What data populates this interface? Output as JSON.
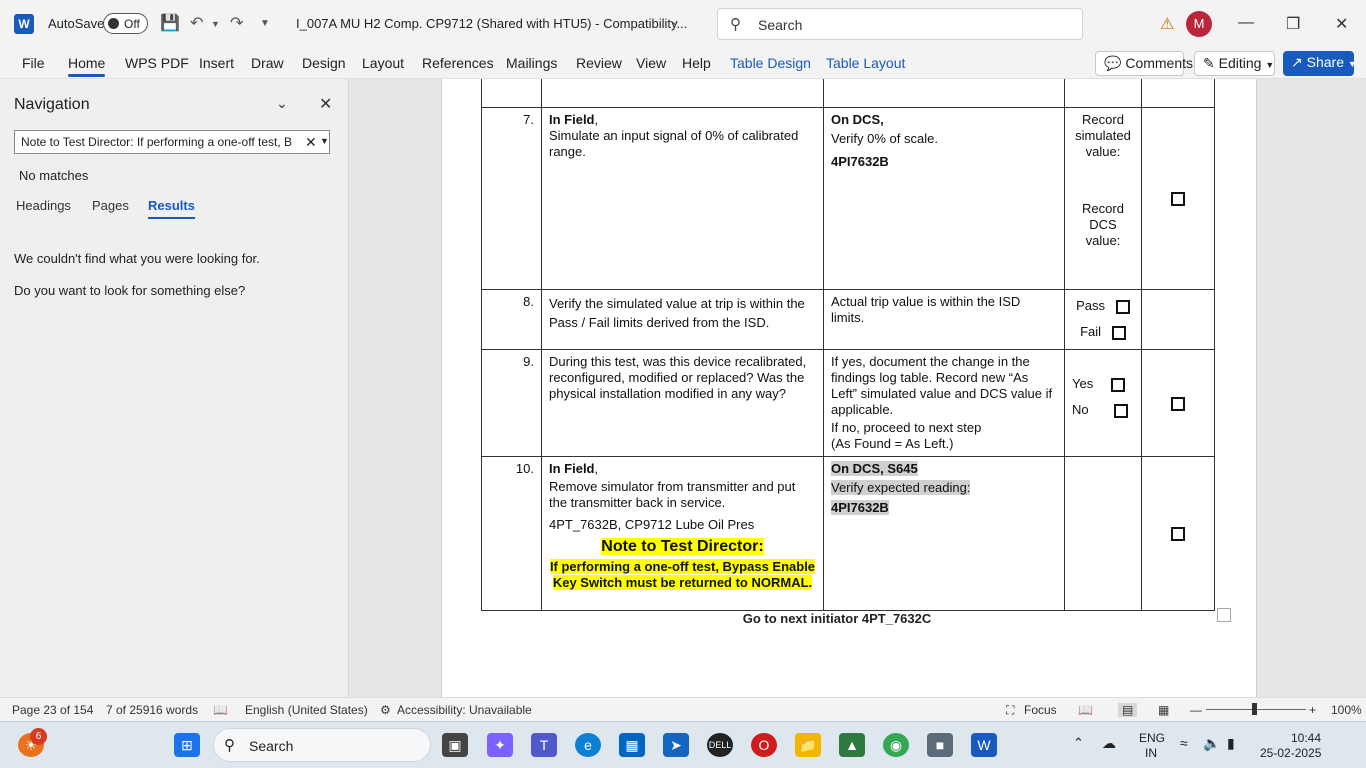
{
  "titlebar": {
    "autosave": "AutoSave",
    "autosave_state": "Off",
    "doc_title": "I_007A MU H2 Comp. CP9712 (Shared with HTU5)  -  Compatibility...",
    "search_placeholder": "Search",
    "avatar_initial": "M"
  },
  "ribbon": {
    "tabs": [
      "File",
      "Home",
      "WPS PDF",
      "Insert",
      "Draw",
      "Design",
      "Layout",
      "References",
      "Mailings",
      "Review",
      "View",
      "Help",
      "Table Design",
      "Table Layout"
    ],
    "comments": "Comments",
    "editing": "Editing",
    "share": "Share"
  },
  "nav": {
    "title": "Navigation",
    "search_value": "Note to Test Director: If performing a one-off test, B",
    "no_matches": "No matches",
    "tabs": [
      "Headings",
      "Pages",
      "Results"
    ],
    "msg1": "We couldn't find what you were looking for.",
    "msg2": "Do you want to look for something else?"
  },
  "doc": {
    "rows": [
      {
        "num": "7.",
        "c2_bold": "In Field",
        "c2_text": "Simulate an input signal of 0% of calibrated range.",
        "c3_bold": "On DCS,",
        "c3_text": "Verify 0% of scale.",
        "c3_tag": "4PI7632B",
        "c4_a": "Record simulated value:",
        "c4_b": "Record DCS value:"
      },
      {
        "num": "8.",
        "c2_text": "Verify the simulated value at trip is within the Pass / Fail limits derived from the ISD.",
        "c3_text": "Actual trip value is within the ISD limits.",
        "c4_a": "Pass",
        "c4_b": "Fail"
      },
      {
        "num": "9.",
        "c2_text": "During this test, was this device recalibrated, reconfigured, modified or replaced? Was the physical installation modified in any way?",
        "c3_text": "If yes, document the change in the findings log table. Record new “As Left” simulated value and DCS value if applicable.",
        "c3_text2": "If no, proceed to next step",
        "c3_text3": "(As Found = As Left.)",
        "c4_a": "Yes",
        "c4_b": "No"
      },
      {
        "num": "10.",
        "c2_bold": "In Field",
        "c2_text": "Remove simulator from transmitter and put the transmitter back in service.",
        "c2_text2": "4PT_7632B, CP9712 Lube Oil Pres",
        "note_heading": "Note to Test Director:",
        "note_body": "If performing a one-off test, Bypass Enable Key Switch must be returned to NORMAL.",
        "c3_bold": "On DCS, S645",
        "c3_text": "Verify expected reading:",
        "c3_tag": "4PI7632B"
      }
    ],
    "goto": "Go to next initiator 4PT_7632C"
  },
  "status": {
    "page": "Page 23 of 154",
    "words": "7 of 25916 words",
    "language": "English (United States)",
    "accessibility": "Accessibility: Unavailable",
    "focus": "Focus",
    "zoom": "100%"
  },
  "taskbar": {
    "badge": "6",
    "search": "Search",
    "lang1": "ENG",
    "lang2": "IN",
    "time": "10:44",
    "date": "25-02-2025"
  }
}
